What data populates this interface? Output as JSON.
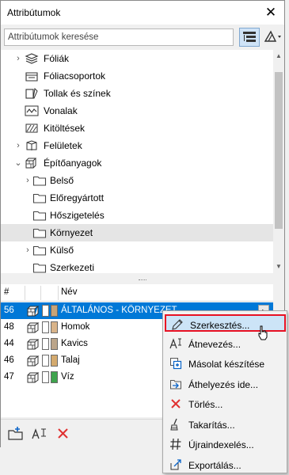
{
  "window": {
    "title": "Attribútumok",
    "close_glyph": "✕"
  },
  "search": {
    "placeholder": "Attribútumok keresése"
  },
  "tree": {
    "items": [
      {
        "label": "Fóliák",
        "icon": "layers-icon"
      },
      {
        "label": "Fóliacsoportok",
        "icon": "layer-combinations-icon"
      },
      {
        "label": "Tollak és színek",
        "icon": "pens-colors-icon"
      },
      {
        "label": "Vonalak",
        "icon": "line-types-icon"
      },
      {
        "label": "Kitöltések",
        "icon": "fills-icon"
      },
      {
        "label": "Felületek",
        "icon": "surfaces-icon"
      },
      {
        "label": "Építőanyagok",
        "icon": "building-materials-icon",
        "expanded": true
      },
      {
        "label": "Belső",
        "icon": "folder-icon"
      },
      {
        "label": "Előregyártott",
        "icon": "folder-icon"
      },
      {
        "label": "Hőszigetelés",
        "icon": "folder-icon"
      },
      {
        "label": "Környezet",
        "icon": "folder-icon",
        "selected": true
      },
      {
        "label": "Külső",
        "icon": "folder-icon"
      },
      {
        "label": "Szerkezeti",
        "icon": "folder-icon"
      }
    ]
  },
  "table": {
    "headers": {
      "index": "#",
      "name": "Név"
    },
    "rows": [
      {
        "index": "56",
        "name": "ÁLTALÁNOS - KÖRNYEZET",
        "fill_color": "#c8a478",
        "selected": true
      },
      {
        "index": "48",
        "name": "Homok",
        "fill_color": "#d9b48a"
      },
      {
        "index": "44",
        "name": "Kavics",
        "fill_color": "#bba58a"
      },
      {
        "index": "46",
        "name": "Talaj",
        "fill_color": "#d4aa6e"
      },
      {
        "index": "47",
        "name": "Víz",
        "fill_color": "#3fa34d"
      }
    ]
  },
  "context_menu": {
    "items": [
      {
        "label": "Szerkesztés...",
        "icon": "pencil-icon",
        "highlighted": true
      },
      {
        "label": "Átnevezés...",
        "icon": "rename-icon"
      },
      {
        "label": "Másolat készítése",
        "icon": "duplicate-icon"
      },
      {
        "label": "Áthelyezés ide...",
        "icon": "move-to-icon"
      },
      {
        "label": "Törlés...",
        "icon": "delete-icon"
      },
      {
        "label": "Takarítás...",
        "icon": "purge-icon"
      },
      {
        "label": "Újraindexelés...",
        "icon": "reindex-icon"
      },
      {
        "label": "Exportálás...",
        "icon": "export-icon"
      }
    ]
  },
  "colors": {
    "selection": "#0078d7",
    "highlight_border": "#e81123",
    "delete_red": "#e03030"
  }
}
